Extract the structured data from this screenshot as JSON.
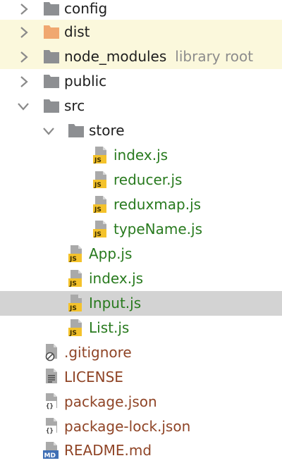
{
  "colors": {
    "folder_gray": "#8d8f92",
    "folder_orange": "#f0a870",
    "excluded_row_bg": "#fbf8dc",
    "selected_row_bg": "#d3d3d3",
    "text_dark": "#1e1e1e",
    "text_green": "#287a1e",
    "text_brown": "#8f4426",
    "hint_gray": "#8c8c8c"
  },
  "tree": {
    "items": [
      {
        "label": "config",
        "icon": "folder-icon",
        "state": "collapsed"
      },
      {
        "label": "dist",
        "icon": "excluded-folder-icon",
        "state": "collapsed"
      },
      {
        "label": "node_modules",
        "hint": "library root",
        "icon": "folder-icon",
        "state": "collapsed"
      },
      {
        "label": "public",
        "icon": "folder-icon",
        "state": "collapsed"
      },
      {
        "label": "src",
        "icon": "folder-icon",
        "state": "expanded"
      },
      {
        "label": "store",
        "icon": "folder-icon",
        "state": "expanded"
      },
      {
        "label": "index.js",
        "icon": "js-file-icon"
      },
      {
        "label": "reducer.js",
        "icon": "js-file-icon"
      },
      {
        "label": "reduxmap.js",
        "icon": "js-file-icon"
      },
      {
        "label": "typeName.js",
        "icon": "js-file-icon"
      },
      {
        "label": "App.js",
        "icon": "js-file-icon"
      },
      {
        "label": "index.js",
        "icon": "js-file-icon"
      },
      {
        "label": "Input.js",
        "icon": "js-file-icon",
        "selected": true
      },
      {
        "label": "List.js",
        "icon": "js-file-icon"
      },
      {
        "label": ".gitignore",
        "icon": "gitignore-file-icon"
      },
      {
        "label": "LICENSE",
        "icon": "text-file-icon"
      },
      {
        "label": "package.json",
        "icon": "json-file-icon"
      },
      {
        "label": "package-lock.json",
        "icon": "json-file-icon"
      },
      {
        "label": "README.md",
        "icon": "markdown-file-icon",
        "badge": "MD"
      }
    ]
  }
}
